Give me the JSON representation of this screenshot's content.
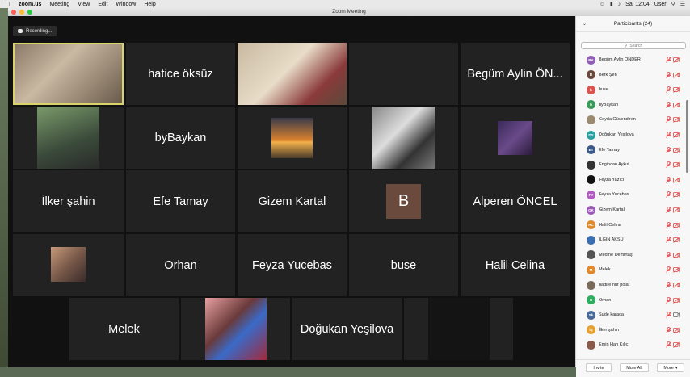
{
  "menubar": {
    "app": "zoom.us",
    "menus": [
      "Meeting",
      "View",
      "Edit",
      "Window",
      "Help"
    ],
    "clock": "Sal 12:04",
    "user": "User"
  },
  "window": {
    "title": "Zoom Meeting"
  },
  "recording": {
    "label": "Recording..."
  },
  "tiles": [
    {
      "name": "",
      "kind": "video",
      "active": true
    },
    {
      "name": "hatice öksüz"
    },
    {
      "name": "",
      "kind": "video"
    },
    {
      "name": "",
      "kind": "blank"
    },
    {
      "name": "Begüm Aylin ÖN..."
    },
    {
      "name": "",
      "kind": "video"
    },
    {
      "name": "byBaykan"
    },
    {
      "name": "",
      "kind": "video"
    },
    {
      "name": "",
      "kind": "video"
    },
    {
      "name": "",
      "kind": "video"
    },
    {
      "name": "İlker şahin"
    },
    {
      "name": "Efe Tamay"
    },
    {
      "name": "Gizem Kartal"
    },
    {
      "name": "",
      "kind": "avatar",
      "initial": "B"
    },
    {
      "name": "Alperen ÖNCEL"
    },
    {
      "name": "",
      "kind": "video"
    },
    {
      "name": "Orhan"
    },
    {
      "name": "Feyza Yucebas"
    },
    {
      "name": "buse"
    },
    {
      "name": "Halil Celina"
    },
    {
      "name": "Melek"
    },
    {
      "name": "",
      "kind": "video"
    },
    {
      "name": "Doğukan Yeşilova"
    },
    {
      "name": "",
      "kind": "blank"
    }
  ],
  "participants": {
    "header": "Participants (24)",
    "search_placeholder": "Search",
    "list": [
      {
        "name": "Begüm Aylin ÖNDER",
        "initials": "BA",
        "color": "#8e5fb5",
        "cam": "off"
      },
      {
        "name": "Berk Şen",
        "initials": "B",
        "color": "#6b4a3e",
        "cam": "off"
      },
      {
        "name": "buse",
        "initials": "b",
        "color": "#d9534f",
        "cam": "off"
      },
      {
        "name": "byBaykan",
        "initials": "b",
        "color": "#3a9a5a",
        "cam": "off"
      },
      {
        "name": "Ceyda Güvendiren",
        "initials": "",
        "color": "#9a8a70",
        "cam": "off"
      },
      {
        "name": "Doğukan Yeşilova",
        "initials": "DY",
        "color": "#2aa0a0",
        "cam": "off"
      },
      {
        "name": "Efe Tamay",
        "initials": "ET",
        "color": "#3d5a8a",
        "cam": "off"
      },
      {
        "name": "Engincan Aykut",
        "initials": "",
        "color": "#333333",
        "cam": "off"
      },
      {
        "name": "Feyza Yazıcı",
        "initials": "",
        "color": "#111111",
        "cam": "off"
      },
      {
        "name": "Feyza Yucebas",
        "initials": "FY",
        "color": "#b05cc0",
        "cam": "off"
      },
      {
        "name": "Gizem Kartal",
        "initials": "GK",
        "color": "#9b59b6",
        "cam": "off"
      },
      {
        "name": "Halil Celina",
        "initials": "HC",
        "color": "#e08a2e",
        "cam": "off"
      },
      {
        "name": "ILGIN AKSU",
        "initials": "",
        "color": "#3c6fb0",
        "cam": "off"
      },
      {
        "name": "Medine Demirtaş",
        "initials": "",
        "color": "#555555",
        "cam": "off"
      },
      {
        "name": "Melek",
        "initials": "M",
        "color": "#e0882e",
        "cam": "off"
      },
      {
        "name": "nadire nur polat",
        "initials": "",
        "color": "#7a6a5a",
        "cam": "off"
      },
      {
        "name": "Orhan",
        "initials": "O",
        "color": "#2eae5e",
        "cam": "off"
      },
      {
        "name": "Sude karaca",
        "initials": "Sk",
        "color": "#4a6a9a",
        "cam": "on"
      },
      {
        "name": "İlker şahin",
        "initials": "İŞ",
        "color": "#e6a02e",
        "cam": "off"
      },
      {
        "name": "Emin Han Kılıç",
        "initials": "",
        "color": "#8a5a4a",
        "cam": "off"
      }
    ],
    "footer": {
      "invite": "Invite",
      "mute_all": "Mute All",
      "more": "More"
    }
  }
}
